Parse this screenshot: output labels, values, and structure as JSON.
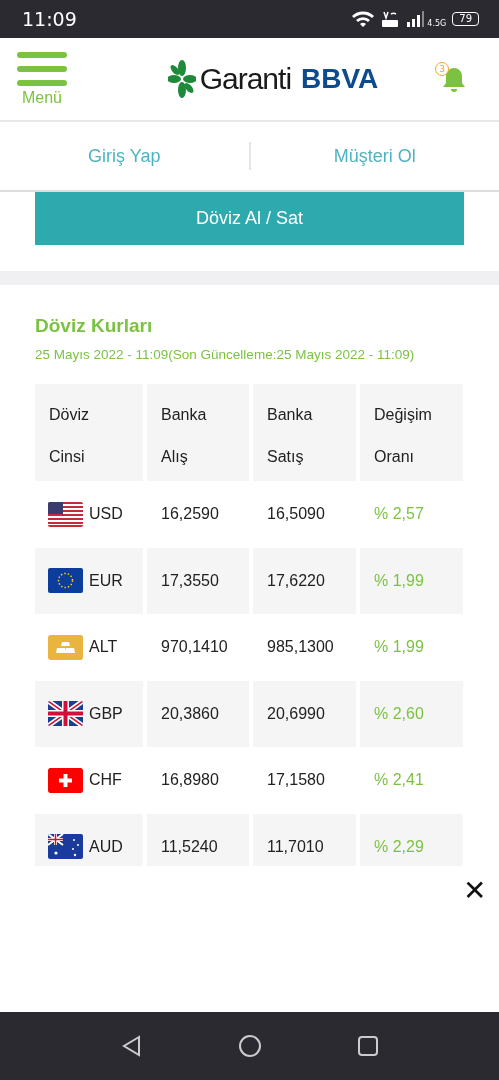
{
  "status_bar": {
    "time": "11:09",
    "network": "4.5G",
    "battery": "79"
  },
  "header": {
    "menu_label": "Menü",
    "logo": {
      "name": "Garanti",
      "brand": "BBVA"
    },
    "notifications": "3"
  },
  "nav_links": [
    {
      "label": "Giriş Yap"
    },
    {
      "label": "Müşteri Ol"
    }
  ],
  "action_button": "Döviz Al / Sat",
  "rates": {
    "title": "Döviz Kurları",
    "updated": "25 Mayıs 2022 - 11:09(Son Güncelleme:25 Mayıs 2022 - 11:09)",
    "columns": [
      [
        "Döviz",
        "Cinsi"
      ],
      [
        "Banka",
        "Alış"
      ],
      [
        "Banka",
        "Satış"
      ],
      [
        "Değişim",
        "Oranı"
      ]
    ],
    "rows": [
      {
        "kind": "usd",
        "code": "USD",
        "buy": "16,2590",
        "sell": "16,5090",
        "change": "% 2,57"
      },
      {
        "kind": "eur",
        "code": "EUR",
        "buy": "17,3550",
        "sell": "17,6220",
        "change": "% 1,99"
      },
      {
        "kind": "gold",
        "code": "ALT",
        "buy": "970,1410",
        "sell": "985,1300",
        "change": "% 1,99"
      },
      {
        "kind": "gbp",
        "code": "GBP",
        "buy": "20,3860",
        "sell": "20,6990",
        "change": "% 2,60"
      },
      {
        "kind": "chf",
        "code": "CHF",
        "buy": "16,8980",
        "sell": "17,1580",
        "change": "% 2,41"
      },
      {
        "kind": "aud",
        "code": "AUD",
        "buy": "11,5240",
        "sell": "11,7010",
        "change": "% 2,29"
      }
    ]
  },
  "close_symbol": "✕"
}
